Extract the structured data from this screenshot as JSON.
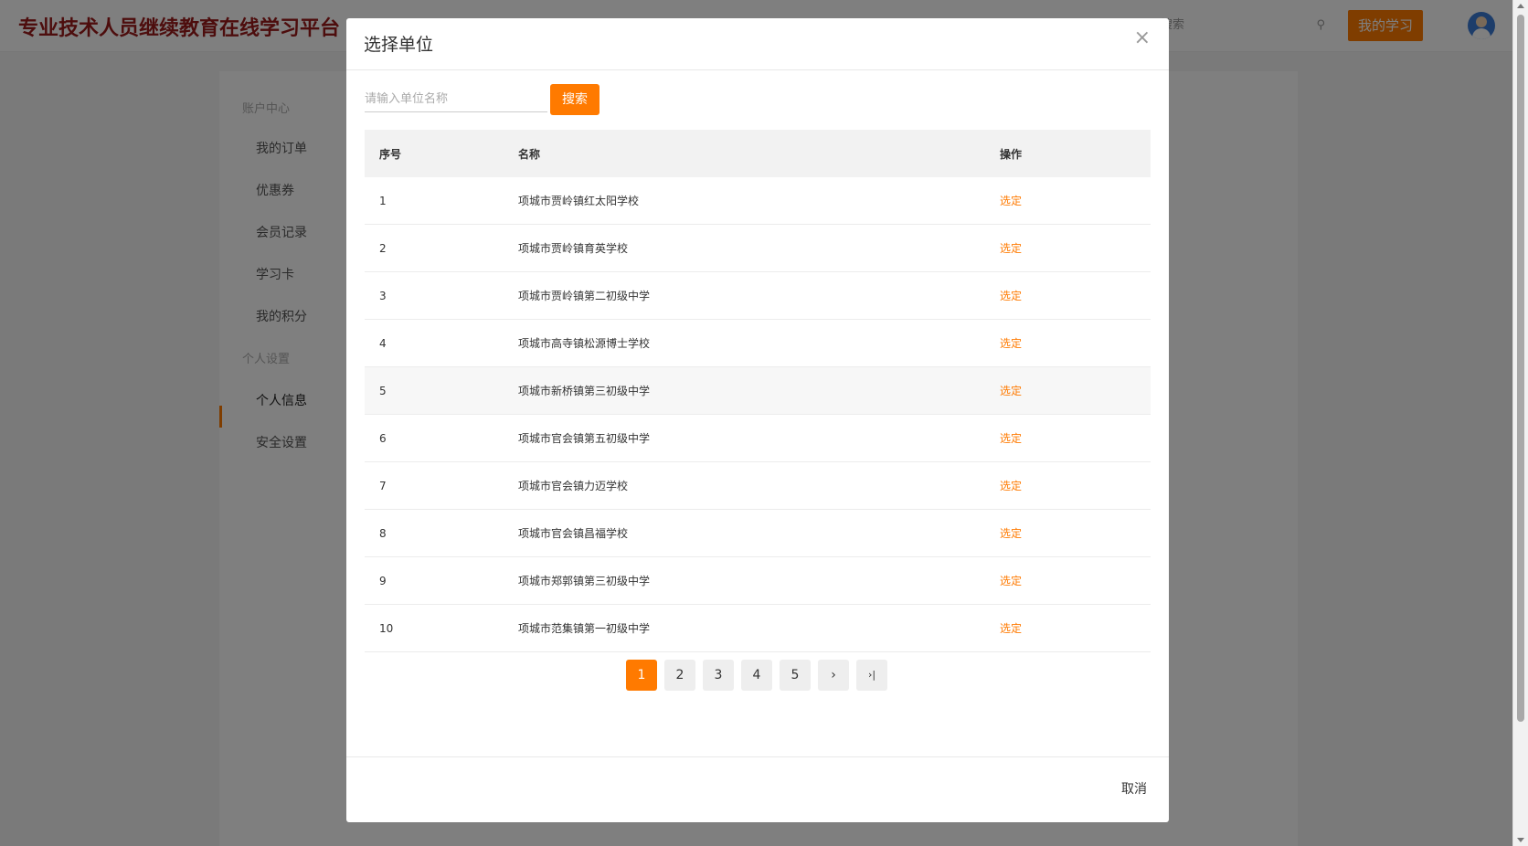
{
  "header": {
    "site_title": "专业技术人员继续教育在线学习平台",
    "search_placeholder": "搜索",
    "my_study_label": "我的学习"
  },
  "sidebar": {
    "groups": [
      {
        "label": "账户中心"
      },
      {
        "label": "个人设置"
      }
    ],
    "items": [
      {
        "label": "我的订单"
      },
      {
        "label": "优惠券"
      },
      {
        "label": "会员记录"
      },
      {
        "label": "学习卡"
      },
      {
        "label": "我的积分"
      },
      {
        "label": "个人信息",
        "active": true
      },
      {
        "label": "安全设置"
      }
    ]
  },
  "modal": {
    "title": "选择单位",
    "close_glyph": "×",
    "search": {
      "placeholder": "请输入单位名称",
      "button_label": "搜索"
    },
    "table": {
      "headers": {
        "index": "序号",
        "name": "名称",
        "action": "操作"
      },
      "rows": [
        {
          "index": "1",
          "name": "项城市贾岭镇红太阳学校",
          "action": "选定"
        },
        {
          "index": "2",
          "name": "项城市贾岭镇育英学校",
          "action": "选定"
        },
        {
          "index": "3",
          "name": "项城市贾岭镇第二初级中学",
          "action": "选定"
        },
        {
          "index": "4",
          "name": "项城市高寺镇松源博士学校",
          "action": "选定"
        },
        {
          "index": "5",
          "name": "项城市新桥镇第三初级中学",
          "action": "选定"
        },
        {
          "index": "6",
          "name": "项城市官会镇第五初级中学",
          "action": "选定"
        },
        {
          "index": "7",
          "name": "项城市官会镇力迈学校",
          "action": "选定"
        },
        {
          "index": "8",
          "name": "项城市官会镇昌福学校",
          "action": "选定"
        },
        {
          "index": "9",
          "name": "项城市郑郭镇第三初级中学",
          "action": "选定"
        },
        {
          "index": "10",
          "name": "项城市范集镇第一初级中学",
          "action": "选定"
        }
      ]
    },
    "pagination": {
      "current": "1",
      "pages": [
        "1",
        "2",
        "3",
        "4",
        "5"
      ],
      "next_glyph": "›",
      "last_glyph": "›|"
    },
    "footer": {
      "cancel_label": "取消"
    }
  },
  "colors": {
    "accent": "#ff7a00",
    "brand_title": "#9b1a1a"
  }
}
